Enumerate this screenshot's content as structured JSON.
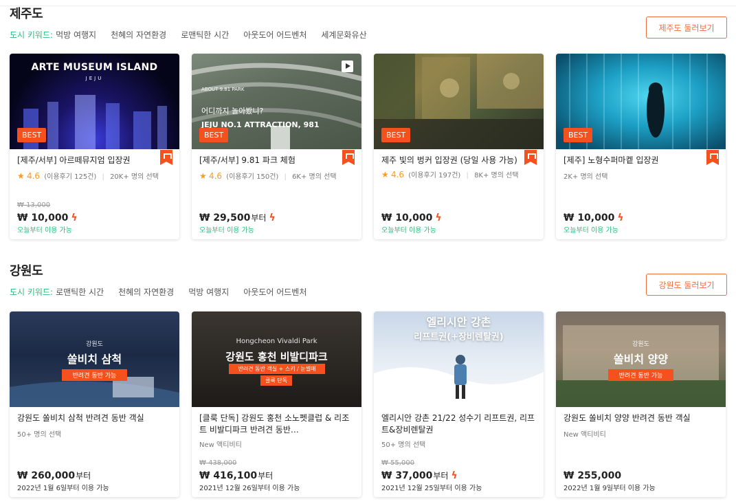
{
  "sections": [
    {
      "title": "제주도",
      "keyword_label": "도시 키워드:",
      "keywords": [
        "먹방 여행지",
        "천혜의 자연환경",
        "로맨틱한 시간",
        "아웃도어 어드벤처",
        "세계문화유산"
      ],
      "browse_label": "제주도 둘러보기",
      "cards": [
        {
          "thumb_title": "ARTE MUSEUM ISLAND",
          "thumb_sub": "JEJU",
          "badge": "BEST",
          "name": "[제주/서부] 아르떼뮤지엄 입장권",
          "rating": "4.6",
          "reviews": "(이용후기 125건)",
          "choices": "20K+ 명의 선택",
          "original_price": "₩ 13,000",
          "price": "₩ 10,000",
          "price_suffix": "",
          "instant": true,
          "availability": "오늘부터 이용 가능"
        },
        {
          "thumb_small": "ABOUT 9.81 PARK",
          "thumb_title": "어디까지 놀아봤니?",
          "thumb_sub": "JEJU NO.1 ATTRACTION, 981",
          "badge": "BEST",
          "name": "[제주/서부] 9.81 파크 체험",
          "rating": "4.6",
          "reviews": "(이용후기 150건)",
          "choices": "6K+ 명의 선택",
          "original_price": "",
          "price": "₩ 29,500",
          "price_suffix": "부터",
          "instant": true,
          "availability": "오늘부터 이용 가능"
        },
        {
          "badge": "BEST",
          "name": "제주 빛의 벙커 입장권 (당일 사용 가능)",
          "rating": "4.6",
          "reviews": "(이용후기 197건)",
          "choices": "8K+ 명의 선택",
          "original_price": "",
          "price": "₩ 10,000",
          "price_suffix": "",
          "instant": true,
          "availability": "오늘부터 이용 가능"
        },
        {
          "badge": "BEST",
          "name": "[제주] 노형수퍼마켙 입장권",
          "choices": "2K+ 명의 선택",
          "original_price": "",
          "price": "₩ 10,000",
          "price_suffix": "",
          "instant": true,
          "availability": "오늘부터 이용 가능"
        }
      ]
    },
    {
      "title": "강원도",
      "keyword_label": "도시 키워드:",
      "keywords": [
        "로맨틱한 시간",
        "천혜의 자연환경",
        "먹방 여행지",
        "아웃도어 어드벤처"
      ],
      "browse_label": "강원도 둘러보기",
      "cards": [
        {
          "thumb_small": "강원도",
          "thumb_title": "쏠비치 삼척",
          "thumb_tag": "반려견 동반 가능",
          "name": "강원도 쏠비치 삼척 반려견 동반 객실",
          "choices": "50+ 명의 선택",
          "original_price": "",
          "price": "₩ 260,000",
          "price_suffix": "부터",
          "instant": false,
          "availability": "2022년 1월 6일부터 이용 가능"
        },
        {
          "thumb_small": "Hongcheon Vivaldi Park",
          "thumb_title": "강원도 홍천 비발디파크",
          "thumb_tag": "반려견 동반 객실 + 스키 / 눈썰매",
          "thumb_tag2": "클룩 단독",
          "name": "[클룩 단독] 강원도 홍천 소노펫클럽 & 리조트 비발디파크 반려견 동반…",
          "choices": "New 액티비티",
          "original_price": "₩ 438,000",
          "price": "₩ 416,100",
          "price_suffix": "부터",
          "instant": false,
          "availability": "2021년 12월 26일부터 이용 가능"
        },
        {
          "thumb_title": "엘리시안 강촌",
          "thumb_sub": "리프트권(+장비렌탈권)",
          "name": "엘리시안 강촌 21/22 성수기 리프트권, 리프트&장비렌탈권",
          "choices": "50+ 명의 선택",
          "original_price": "₩ 55,000",
          "price": "₩ 37,000",
          "price_suffix": "부터",
          "instant": true,
          "availability": "2021년 12월 25일부터 이용 가능"
        },
        {
          "thumb_small": "강원도",
          "thumb_title": "쏠비치 양양",
          "thumb_tag": "반려견 동반 가능",
          "name": "강원도 쏠비치 양양 반려견 동반 객실",
          "choices": "New 액티비티",
          "original_price": "",
          "price": "₩ 255,000",
          "price_suffix": "",
          "instant": false,
          "availability": "2022년 1월 9일부터 이용 가능"
        }
      ]
    }
  ],
  "colors": {
    "accent": "#f26b3a",
    "badge": "#f4511e",
    "green": "#2dbd7e",
    "star": "#ff9a1f"
  }
}
